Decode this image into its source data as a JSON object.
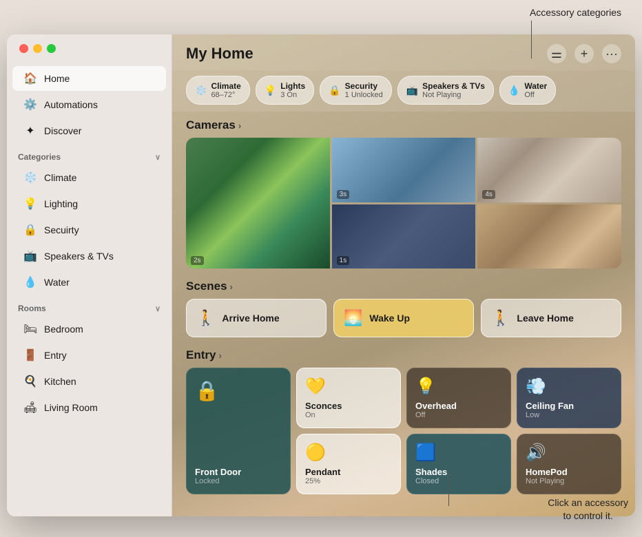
{
  "annotations": {
    "top_label": "Accessory categories",
    "bottom_label": "Click an accessory\nto control it."
  },
  "window": {
    "title": "My Home"
  },
  "header": {
    "title": "My Home",
    "btn_equalizer": "⚌",
    "btn_add": "+",
    "btn_more": "•••"
  },
  "category_tabs": [
    {
      "icon": "❄️",
      "label": "Climate",
      "sub": "68–72°"
    },
    {
      "icon": "💡",
      "label": "Lights",
      "sub": "3 On"
    },
    {
      "icon": "🔒",
      "label": "Security",
      "sub": "1 Unlocked"
    },
    {
      "icon": "📺",
      "label": "Speakers & TVs",
      "sub": "Not Playing"
    },
    {
      "icon": "💧",
      "label": "Water",
      "sub": "Off"
    }
  ],
  "cameras_section": {
    "title": "Cameras"
  },
  "cameras": [
    {
      "id": "cam1",
      "timestamp": "2s",
      "span": true
    },
    {
      "id": "cam2",
      "timestamp": "3s",
      "span": false
    },
    {
      "id": "cam3",
      "timestamp": "",
      "span": false
    },
    {
      "id": "cam4",
      "timestamp": "1s",
      "span": false
    },
    {
      "id": "cam5",
      "timestamp": "4s",
      "span": false
    }
  ],
  "scenes_section": {
    "title": "Scenes"
  },
  "scenes": [
    {
      "id": "arrive-home",
      "icon": "🚶",
      "label": "Arrive Home",
      "active": false
    },
    {
      "id": "wake-up",
      "icon": "🌅",
      "label": "Wake Up",
      "active": true
    },
    {
      "id": "leave-home",
      "icon": "🚶",
      "label": "Leave Home",
      "active": false
    }
  ],
  "entry_section": {
    "title": "Entry"
  },
  "accessories": [
    {
      "id": "front-door",
      "icon": "🔒",
      "name": "Front Door",
      "status": "Locked",
      "style": "cyan-accent"
    },
    {
      "id": "sconces",
      "icon": "💡",
      "name": "Sconces",
      "status": "On",
      "style": "light"
    },
    {
      "id": "overhead",
      "icon": "💡",
      "name": "Overhead",
      "status": "Off",
      "style": "dark"
    },
    {
      "id": "ceiling-fan",
      "icon": "💨",
      "name": "Ceiling Fan",
      "status": "Low",
      "style": "blue-accent"
    },
    {
      "id": "front-door-2",
      "icon": "",
      "name": "",
      "status": "",
      "style": "hidden"
    },
    {
      "id": "pendant",
      "icon": "💡",
      "name": "Pendant",
      "status": "25%",
      "style": "light"
    },
    {
      "id": "shades",
      "icon": "🪟",
      "name": "Shades",
      "status": "Closed",
      "style": "dark"
    },
    {
      "id": "homepod",
      "icon": "🔊",
      "name": "HomePod",
      "status": "Not Playing",
      "style": "dark"
    }
  ],
  "sidebar": {
    "main_nav": [
      {
        "id": "home",
        "icon": "🏠",
        "label": "Home",
        "active": true
      },
      {
        "id": "automations",
        "icon": "⚙️",
        "label": "Automations",
        "active": false
      },
      {
        "id": "discover",
        "icon": "✦",
        "label": "Discover",
        "active": false
      }
    ],
    "categories_header": "Categories",
    "categories": [
      {
        "id": "climate",
        "icon": "❄️",
        "label": "Climate"
      },
      {
        "id": "lighting",
        "icon": "💡",
        "label": "Lighting"
      },
      {
        "id": "security",
        "icon": "🔒",
        "label": "Secuirty"
      },
      {
        "id": "speakers-tvs",
        "icon": "📺",
        "label": "Speakers & TVs"
      },
      {
        "id": "water",
        "icon": "💧",
        "label": "Water"
      }
    ],
    "rooms_header": "Rooms",
    "rooms": [
      {
        "id": "bedroom",
        "icon": "🛏",
        "label": "Bedroom"
      },
      {
        "id": "entry",
        "icon": "🚪",
        "label": "Entry"
      },
      {
        "id": "kitchen",
        "icon": "🍳",
        "label": "Kitchen"
      },
      {
        "id": "living-room",
        "icon": "🛋",
        "label": "Living Room"
      }
    ]
  }
}
